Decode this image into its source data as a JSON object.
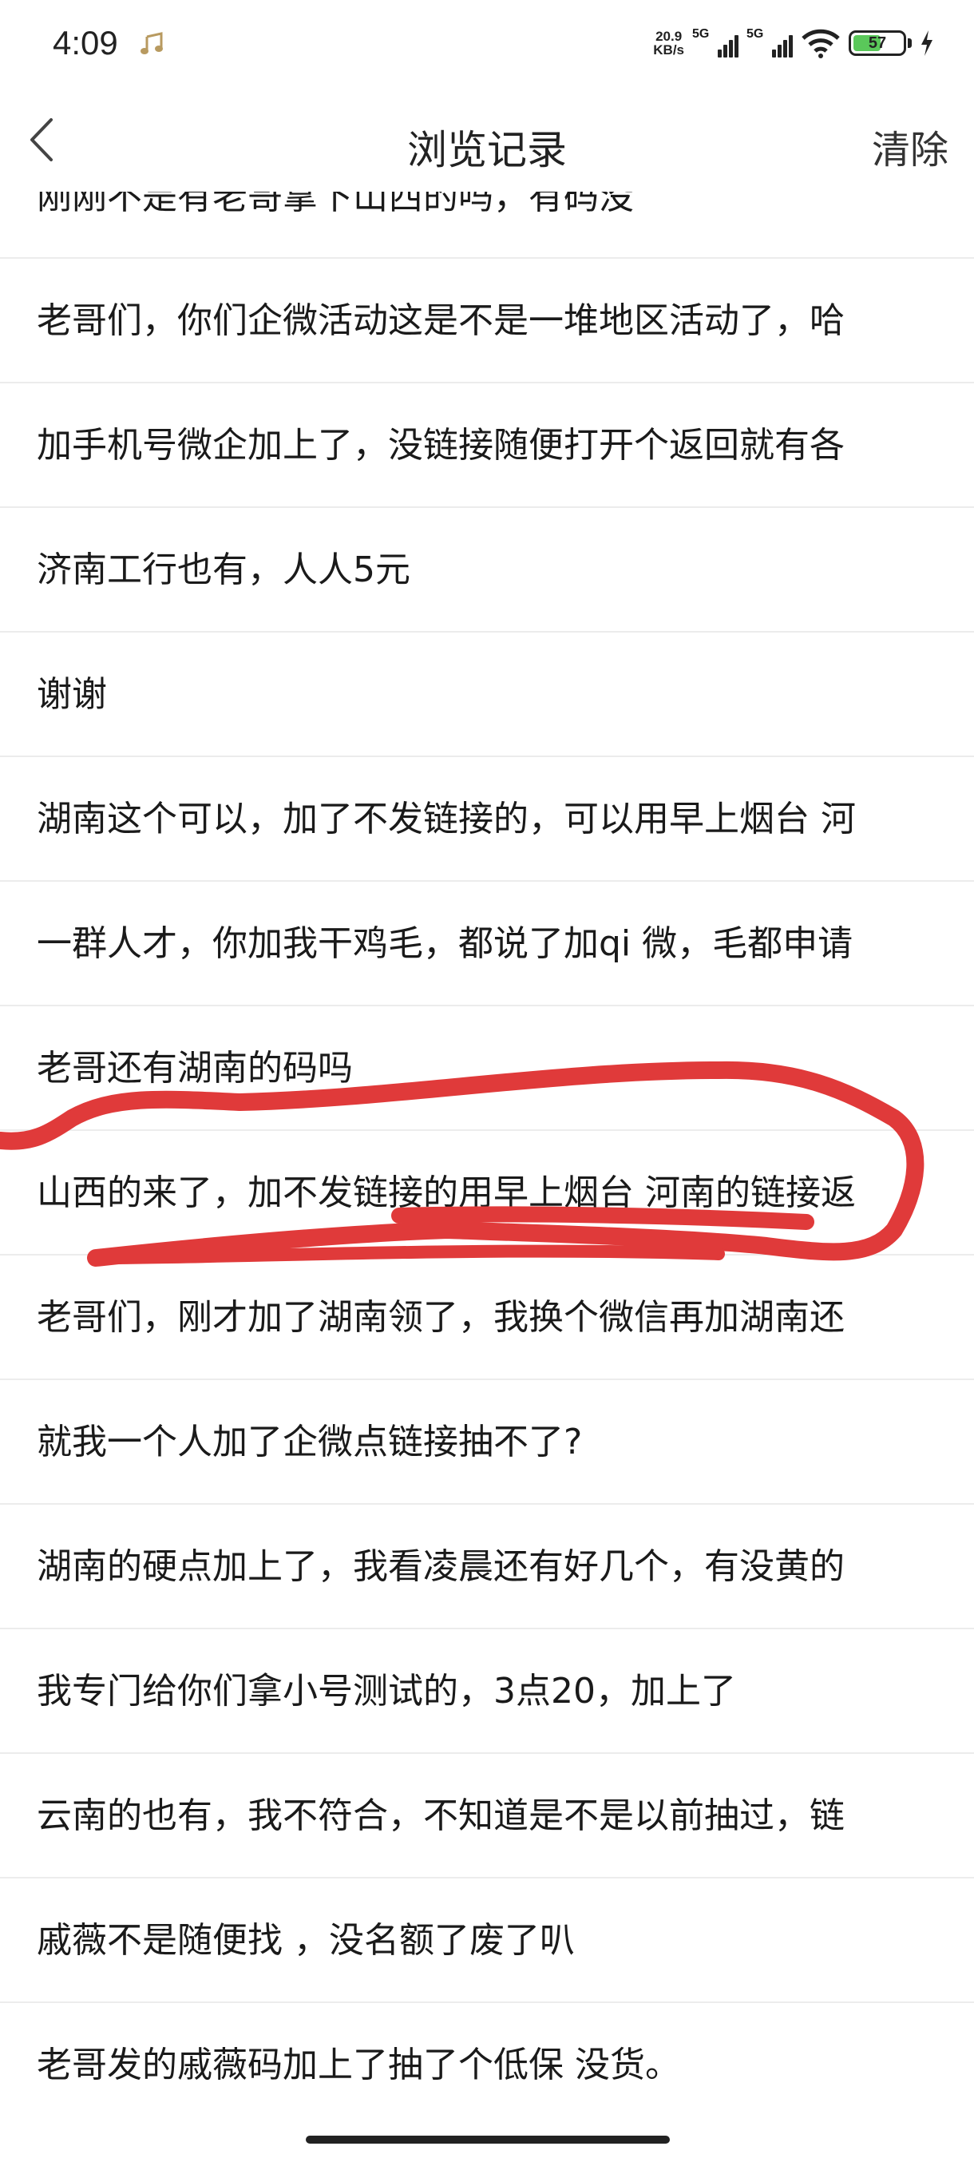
{
  "status_bar": {
    "time": "4:09",
    "net_speed_value": "20.9",
    "net_speed_unit": "KB/s",
    "signal1_label": "5G",
    "signal2_label": "5G",
    "battery_level": "57",
    "battery_color": "#5ac85a"
  },
  "header": {
    "back_icon": "chevron-left-icon",
    "title": "浏览记录",
    "clear_label": "清除"
  },
  "history": {
    "partial_item": "刚刚不是有老哥拿下山西的吗，有码没",
    "items": [
      "老哥们，你们企微活动这是不是一堆地区活动了，哈",
      "加手机号微企加上了，没链接随便打开个返回就有各",
      "济南工行也有，人人5元",
      "谢谢",
      "湖南这个可以，加了不发链接的，可以用早上烟台 河",
      "一群人才，你加我干鸡毛，都说了加qi 微，毛都申请",
      "老哥还有湖南的码吗",
      "山西的来了，加不发链接的用早上烟台 河南的链接返",
      "老哥们，刚才加了湖南领了，我换个微信再加湖南还",
      "就我一个人加了企微点链接抽不了?",
      "湖南的硬点加上了，我看凌晨还有好几个，有没黄的",
      "我专门给你们拿小号测试的，3点20，加上了",
      "云南的也有，我不符合，不知道是不是以前抽过，链",
      "戚薇不是随便找 ，没名额了废了叭",
      "老哥发的戚薇码加上了抽了个低保 没货。"
    ]
  },
  "annotation": {
    "color": "#e03a3a"
  }
}
